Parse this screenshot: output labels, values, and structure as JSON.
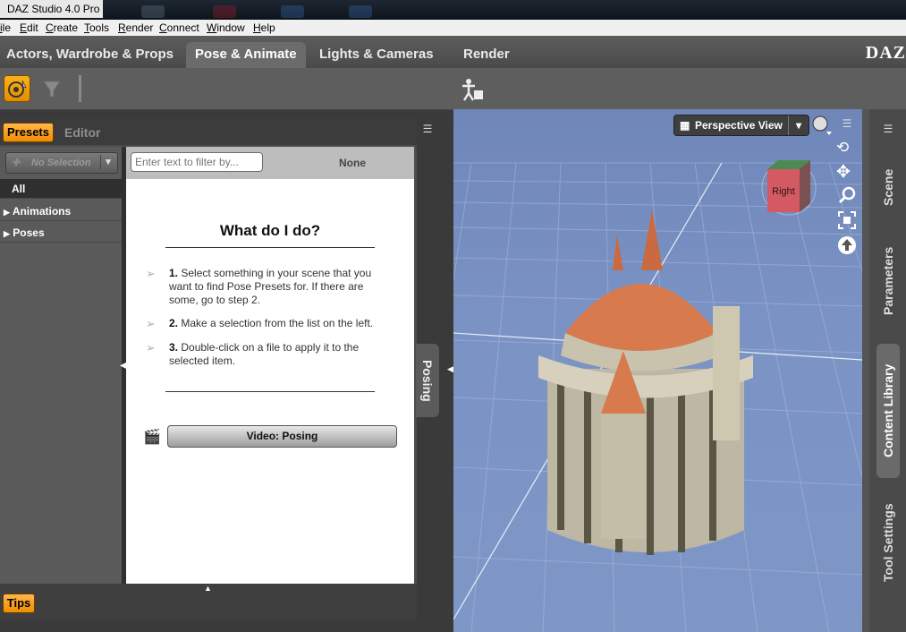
{
  "window": {
    "title": "DAZ Studio 4.0 Pro"
  },
  "menu": [
    "ile",
    "Edit",
    "Create",
    "Tools",
    "Render",
    "Connect",
    "Window",
    "Help"
  ],
  "tabs": [
    {
      "label": "Actors, Wardrobe & Props"
    },
    {
      "label": "Pose & Animate"
    },
    {
      "label": "Lights & Cameras"
    },
    {
      "label": "Render"
    }
  ],
  "brand": "DAZ",
  "left_pane": {
    "tabs": {
      "presets": "Presets",
      "editor": "Editor"
    },
    "selection": "No Selection",
    "categories": [
      "All",
      "Animations",
      "Poses"
    ],
    "filter_placeholder": "Enter text to filter by...",
    "none_label": "None",
    "help_title": "What do I do?",
    "steps": [
      {
        "num": "1.",
        "text": "Select something in your scene that you want to find Pose Presets for. If there are some, go to step 2."
      },
      {
        "num": "2.",
        "text": "Make a selection from the list on the left."
      },
      {
        "num": "3.",
        "text": "Double-click on a file to apply it to the selected item."
      }
    ],
    "video_button": "Video: Posing",
    "tips": "Tips",
    "side_tab": "Posing"
  },
  "viewport": {
    "view_label": "Perspective View",
    "cube_face": "Right"
  },
  "right_pane": {
    "tabs": [
      "Scene",
      "Parameters",
      "Content Library",
      "Tool Settings"
    ]
  }
}
